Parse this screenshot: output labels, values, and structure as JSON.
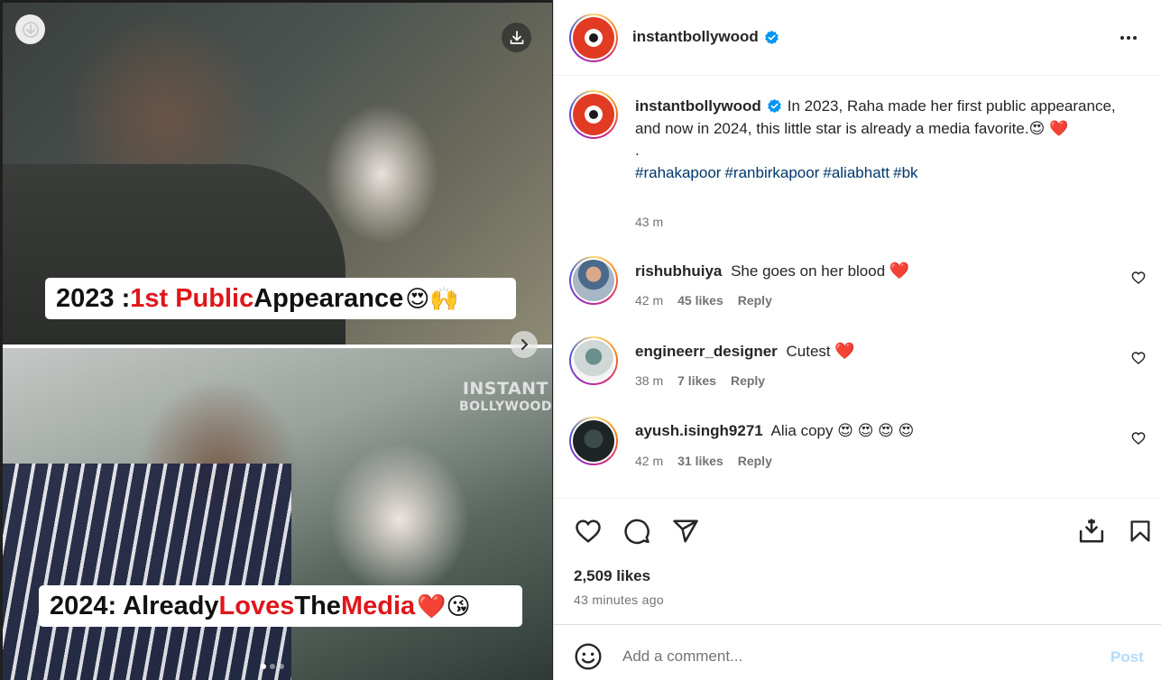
{
  "media": {
    "top_caption": {
      "year": "2023 : ",
      "red": "1st Public",
      "rest": " Appearance",
      "emoji": "😍🙌"
    },
    "bottom_caption": {
      "year": "2024: Already ",
      "red": "Loves",
      "mid": " The ",
      "red2": "Media",
      "emoji": "❤️😘"
    },
    "watermark": {
      "line1": "INSTANT",
      "line2": "BOLLYWOOD"
    },
    "icons": [
      "download-icon",
      "chevron-right-icon"
    ],
    "carousel_count": 3
  },
  "header": {
    "username": "instantbollywood",
    "verified": true,
    "more_icon": "more-icon"
  },
  "caption": {
    "username": "instantbollywood",
    "text": "In 2023, Raha made her first public appearance, and now in 2024, this little star is already a media favorite.😍 ❤️",
    "separator": ".",
    "hashtags": [
      "#rahakapoor",
      "#ranbirkapoor",
      "#aliabhatt",
      "#bk"
    ],
    "time": "43 m"
  },
  "comments": [
    {
      "username": "rishubhuiya",
      "text": "She goes on her blood",
      "emoji": "❤️",
      "time": "42 m",
      "likes": "45 likes",
      "reply": "Reply"
    },
    {
      "username": "engineerr_designer",
      "text": "Cutest",
      "emoji": "❤️",
      "time": "38 m",
      "likes": "7 likes",
      "reply": "Reply"
    },
    {
      "username": "ayush.isingh9271",
      "text": "Alia copy",
      "emoji": "😍 😍 😍 😍",
      "time": "42 m",
      "likes": "31 likes",
      "reply": "Reply"
    }
  ],
  "actions": {
    "likes": "2,509 likes",
    "posted": "43 minutes ago",
    "icons": [
      "heart-icon",
      "comment-icon",
      "share-icon",
      "save-icon",
      "bookmark-icon"
    ]
  },
  "comment_bar": {
    "placeholder": "Add a comment...",
    "post_label": "Post"
  },
  "colors": {
    "accent_red": "#e0161b",
    "hashtag": "#00376b",
    "muted": "#737373",
    "verified_blue": "#0095f6",
    "post_disabled": "#b3dbff"
  }
}
